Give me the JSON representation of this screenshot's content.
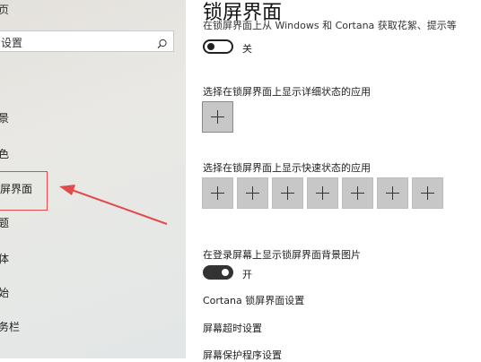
{
  "sidebar": {
    "top_fragment": "页",
    "search_placeholder": "设置",
    "items": [
      {
        "label": "景"
      },
      {
        "label": "色"
      },
      {
        "label": "屏界面"
      },
      {
        "label": "题"
      },
      {
        "label": "体"
      },
      {
        "label": "始"
      },
      {
        "label": "务栏"
      }
    ]
  },
  "main": {
    "title": "锁屏界面",
    "clipped_text": "在锁屏界面上从 Windows 和 Cortana 获取花絮、提示等",
    "toggle_fun_facts": {
      "state_label": "关",
      "on": false
    },
    "detail_status_label": "选择在锁屏界面上显示详细状态的应用",
    "quick_status_label": "选择在锁屏界面上显示快速状态的应用",
    "quick_status_slot_count": 7,
    "signin_background_label": "在登录屏幕上显示锁屏界面背景图片",
    "toggle_signin_background": {
      "state_label": "开",
      "on": true
    },
    "links": {
      "cortana": "Cortana 锁屏界面设置",
      "timeout": "屏幕超时设置",
      "screensaver": "屏幕保护程序设置"
    }
  },
  "annotation": {
    "arrow_color": "#e24b4b",
    "highlight_color": "#e24b4b"
  }
}
